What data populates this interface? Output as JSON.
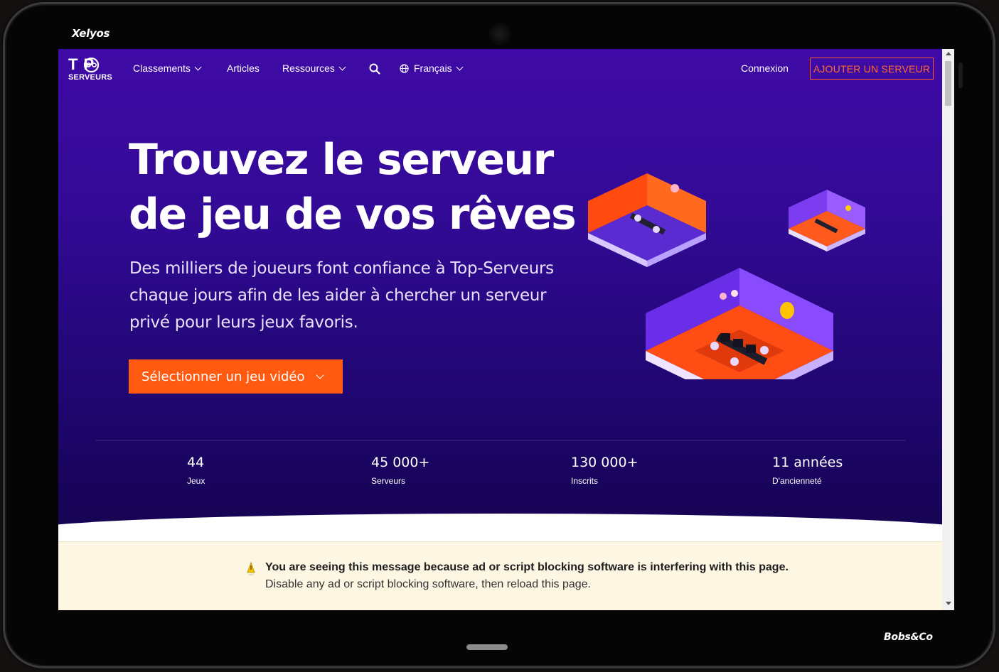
{
  "device": {
    "brand_top": "Xelyos",
    "brand_bottom": "Bobs&Co"
  },
  "nav": {
    "logo_top": "T  P",
    "logo_bottom": "SERVEURS",
    "items": [
      {
        "label": "Classements",
        "dropdown": true
      },
      {
        "label": "Articles",
        "dropdown": false
      },
      {
        "label": "Ressources",
        "dropdown": true
      }
    ],
    "language": "Français",
    "login": "Connexion",
    "add_server": "AJOUTER UN SERVEUR"
  },
  "hero": {
    "headline_line1": "Trouvez le serveur",
    "headline_line2": "de jeu de vos rêves",
    "lead": "Des milliers de joueurs font confiance à Top-Serveurs chaque jours afin de les aider à chercher un serveur privé pour leurs jeux favoris.",
    "cta": "Sélectionner un jeu vidéo"
  },
  "stats": [
    {
      "value": "44",
      "label": "Jeux"
    },
    {
      "value": "45 000+",
      "label": "Serveurs"
    },
    {
      "value": "130 000+",
      "label": "Inscrits"
    },
    {
      "value": "11 années",
      "label": "D'ancienneté"
    }
  ],
  "notice": {
    "title": "You are seeing this message because ad or script blocking software is interfering with this page.",
    "body": "Disable any ad or script blocking software, then reload this page."
  },
  "colors": {
    "hero_top": "#3f0aa6",
    "hero_bottom": "#15034f",
    "accent": "#ff5a0f",
    "notice_bg": "#fcf6e3"
  }
}
